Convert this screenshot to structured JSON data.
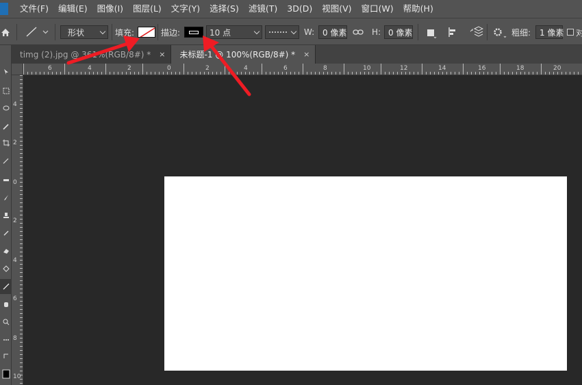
{
  "menu": {
    "items": [
      "文件(F)",
      "编辑(E)",
      "图像(I)",
      "图层(L)",
      "文字(Y)",
      "选择(S)",
      "滤镜(T)",
      "3D(D)",
      "视图(V)",
      "窗口(W)",
      "帮助(H)"
    ]
  },
  "options": {
    "mode": "形状",
    "fill_label": "填充:",
    "stroke_label": "描边:",
    "stroke_size": "10 点",
    "w_label": "W:",
    "w_value": "0 像素",
    "h_label": "H:",
    "h_value": "0 像素",
    "weight_label": "粗细:",
    "weight_value": "1 像素",
    "trailing_char": "对"
  },
  "tabs": [
    {
      "label": "timg (2).jpg @ 361%(RGB/8#) *",
      "close": "×",
      "active": false
    },
    {
      "label": "未标题-1 @ 100%(RGB/8#) *",
      "close": "×",
      "active": true
    }
  ],
  "ruler_h": [
    "6",
    "4",
    "2",
    "0",
    "2",
    "4",
    "6",
    "8",
    "10",
    "12",
    "14",
    "16",
    "18",
    "20"
  ],
  "ruler_v": [
    "4",
    "2",
    "0",
    "2",
    "4",
    "6",
    "8",
    "10"
  ],
  "colors": {
    "arrow": "#ee1c24",
    "chrome": "#535353",
    "workspace": "#282828",
    "document": "#ffffff"
  }
}
